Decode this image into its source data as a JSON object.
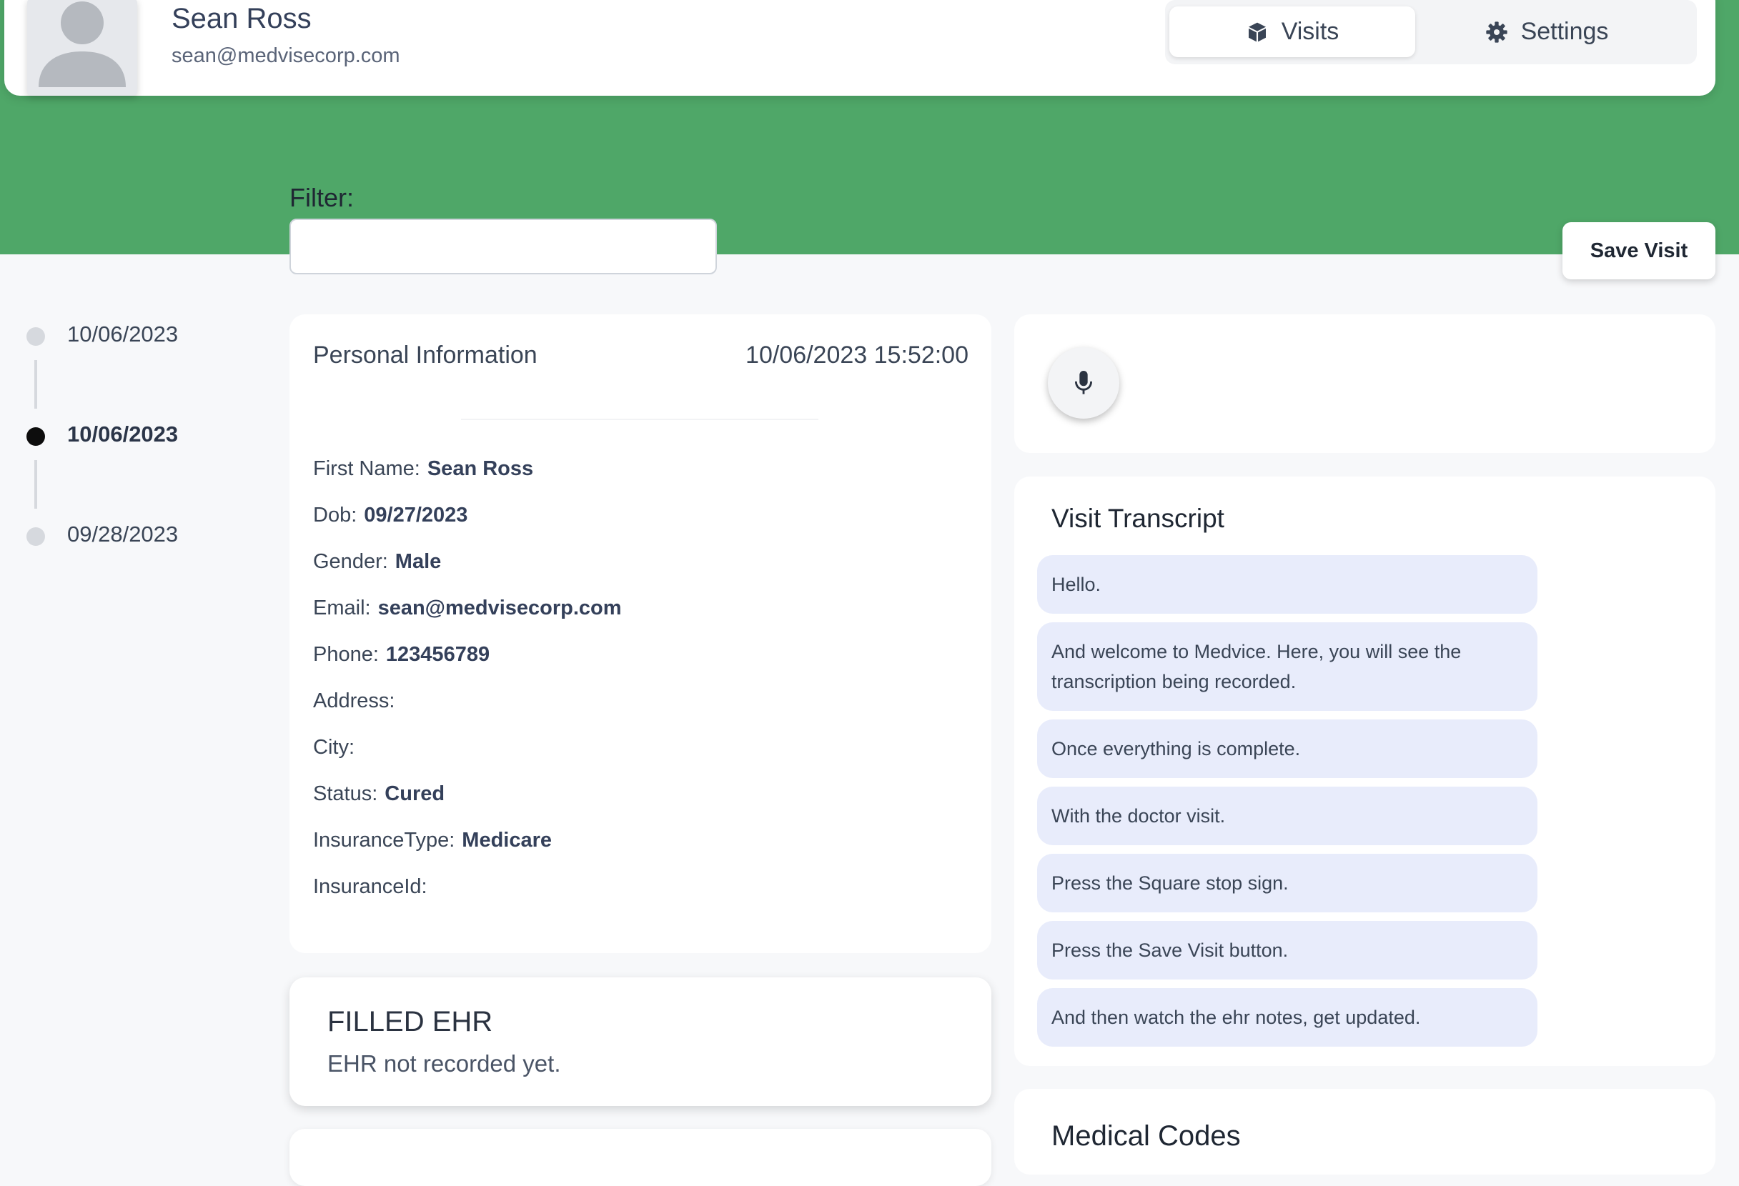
{
  "user": {
    "name": "Sean Ross",
    "email": "sean@medvisecorp.com"
  },
  "nav": {
    "tabs": [
      {
        "label": "Visits",
        "icon": "cube-icon"
      },
      {
        "label": "Settings",
        "icon": "gear-icon"
      }
    ]
  },
  "filter": {
    "label": "Filter:",
    "value": "",
    "placeholder": ""
  },
  "actions": {
    "save_visit": "Save Visit"
  },
  "timeline": [
    {
      "date": "10/06/2023",
      "active": false
    },
    {
      "date": "10/06/2023",
      "active": true
    },
    {
      "date": "09/28/2023",
      "active": false
    }
  ],
  "personal_info": {
    "title": "Personal Information",
    "timestamp": "10/06/2023 15:52:00",
    "fields": [
      {
        "label": "First Name:",
        "value": "Sean Ross"
      },
      {
        "label": "Dob:",
        "value": "09/27/2023"
      },
      {
        "label": "Gender:",
        "value": "Male"
      },
      {
        "label": "Email:",
        "value": "sean@medvisecorp.com"
      },
      {
        "label": "Phone:",
        "value": "123456789"
      },
      {
        "label": "Address:",
        "value": ""
      },
      {
        "label": "City:",
        "value": ""
      },
      {
        "label": "Status:",
        "value": "Cured"
      },
      {
        "label": "InsuranceType:",
        "value": "Medicare"
      },
      {
        "label": "InsuranceId:",
        "value": ""
      }
    ]
  },
  "ehr": {
    "title": "FILLED EHR",
    "text": "EHR not recorded yet."
  },
  "recorder": {
    "icon": "microphone-icon"
  },
  "transcript": {
    "title": "Visit Transcript",
    "lines": [
      "Hello.",
      "And welcome to Medvice. Here, you will see the transcription being recorded.",
      "Once everything is complete.",
      "With the doctor visit.",
      "Press the Square stop sign.",
      "Press the Save Visit button.",
      "And then watch the ehr notes, get updated."
    ]
  },
  "medical_codes": {
    "title": "Medical Codes"
  },
  "colors": {
    "accent_green": "#4fa768",
    "bubble_bg": "#e8ecfb",
    "active_dot": "#0d0d0d"
  }
}
